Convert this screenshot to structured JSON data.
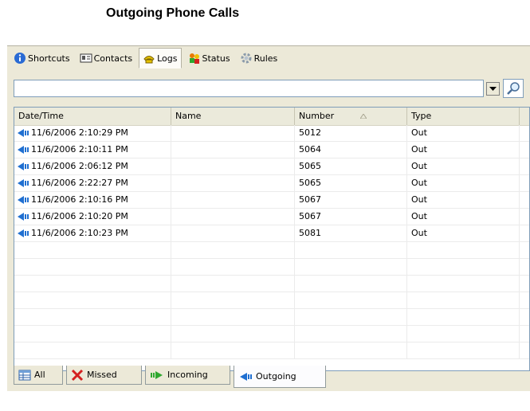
{
  "page_title": "Outgoing Phone Calls",
  "toolbar": {
    "items": [
      {
        "label": "Shortcuts",
        "icon": "info-icon"
      },
      {
        "label": "Contacts",
        "icon": "contacts-card-icon"
      },
      {
        "label": "Logs",
        "icon": "phone-log-icon",
        "active": true
      },
      {
        "label": "Status",
        "icon": "people-status-icon"
      },
      {
        "label": "Rules",
        "icon": "gear-icon"
      }
    ]
  },
  "search": {
    "value": "",
    "placeholder": ""
  },
  "table": {
    "columns": [
      "Date/Time",
      "Name",
      "Number",
      "Type"
    ],
    "sorted_column": "Number",
    "rows": [
      {
        "datetime": "11/6/2006 2:10:29 PM",
        "name": "",
        "number": "5012",
        "type": "Out"
      },
      {
        "datetime": "11/6/2006 2:10:11 PM",
        "name": "",
        "number": "5064",
        "type": "Out"
      },
      {
        "datetime": "11/6/2006 2:06:12 PM",
        "name": "",
        "number": "5065",
        "type": "Out"
      },
      {
        "datetime": "11/6/2006 2:22:27 PM",
        "name": "",
        "number": "5065",
        "type": "Out"
      },
      {
        "datetime": "11/6/2006 2:10:16 PM",
        "name": "",
        "number": "5067",
        "type": "Out"
      },
      {
        "datetime": "11/6/2006 2:10:20 PM",
        "name": "",
        "number": "5067",
        "type": "Out"
      },
      {
        "datetime": "11/6/2006 2:10:23 PM",
        "name": "",
        "number": "5081",
        "type": "Out"
      }
    ]
  },
  "filter_tabs": [
    {
      "label": "All",
      "icon": "table-icon"
    },
    {
      "label": "Missed",
      "icon": "red-x-icon"
    },
    {
      "label": "Incoming",
      "icon": "green-arrow-icon"
    },
    {
      "label": "Outgoing",
      "icon": "blue-arrow-icon",
      "active": true
    }
  ],
  "colors": {
    "outgoing_arrow": "#1f6fd1",
    "incoming_arrow": "#2fa82f",
    "missed_x": "#d42020"
  }
}
